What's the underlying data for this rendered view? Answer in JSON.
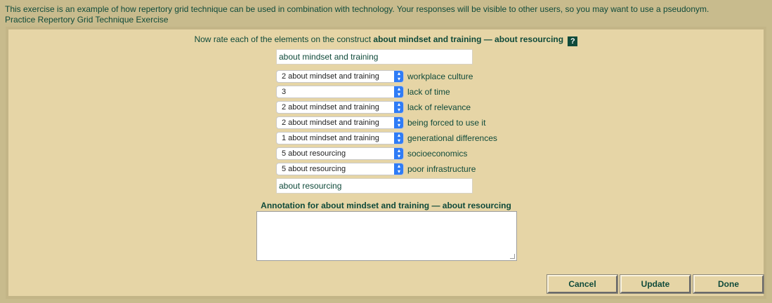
{
  "header": {
    "notice": "This exercise is an example of how repertory grid technique can be used in combination with technology. Your responses will be visible to other users, so you may want to use a pseudonym.",
    "title": "Practice Repertory Grid Technique Exercise"
  },
  "prompt": {
    "prefix": "Now rate each of the elements on the construct",
    "construct": "about mindset and training — about resourcing",
    "help_icon_glyph": "?"
  },
  "poles": {
    "left": "about mindset and training",
    "right": "about resourcing"
  },
  "ratings": [
    {
      "selected": "2 about mindset and training",
      "element": "workplace culture"
    },
    {
      "selected": "3",
      "element": "lack of time"
    },
    {
      "selected": "2 about mindset and training",
      "element": "lack of relevance"
    },
    {
      "selected": "2 about mindset and training",
      "element": "being forced to use it"
    },
    {
      "selected": "1 about mindset and training",
      "element": "generational differences"
    },
    {
      "selected": "5 about resourcing",
      "element": "socioeconomics"
    },
    {
      "selected": "5 about resourcing",
      "element": "poor infrastructure"
    }
  ],
  "annotation": {
    "label": "Annotation for about mindset and training — about resourcing",
    "value": ""
  },
  "buttons": {
    "cancel": "Cancel",
    "update": "Update",
    "done": "Done"
  },
  "colors": {
    "page_background": "#c8bb8d",
    "panel_background": "#e6d5a6",
    "text": "#0f4a3a",
    "select_accent": "#2f7cf6"
  }
}
